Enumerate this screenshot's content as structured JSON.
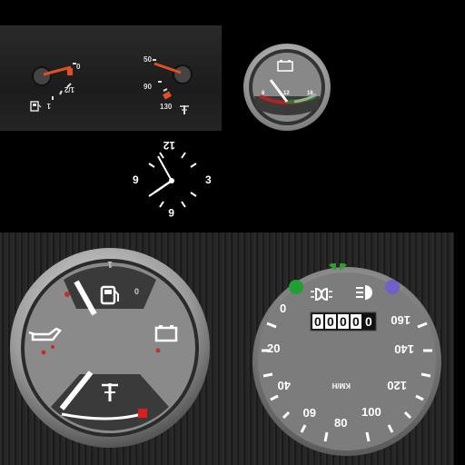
{
  "fuel_temp_panel": {
    "fuel_labels": [
      "0",
      "1/2",
      "1"
    ],
    "temp_labels": [
      "50",
      "90",
      "130"
    ],
    "fuel_icon": "fuel-pump-icon",
    "temp_icon": "coolant-thermometer-icon"
  },
  "battery_gauge": {
    "labels": [
      "8",
      "12",
      "16"
    ],
    "icon": "battery-icon"
  },
  "clock": {
    "labels": [
      "12",
      "3",
      "6",
      "9"
    ]
  },
  "combo_gauge": {
    "fuel_labels": [
      "0",
      "1/2",
      "1"
    ],
    "icons": [
      "fuel-pump-icon",
      "oil-can-icon",
      "battery-icon",
      "coolant-thermometer-icon"
    ],
    "accent_red": "#d82020"
  },
  "speedometer": {
    "odometer": [
      "0",
      "0",
      "0",
      "0",
      "0"
    ],
    "speed_labels": [
      "0",
      "20",
      "40",
      "60",
      "80",
      "100",
      "120",
      "140",
      "160"
    ],
    "unit": "KM/H",
    "indicator_icons": [
      "turn-signal-icon",
      "high-beam-icon",
      "parking-light-icon",
      "low-beam-icon"
    ],
    "colors": {
      "turn": "#2ea02e",
      "low_beam_dot": "#20a030",
      "high_beam_dot": "#7060c8"
    }
  }
}
